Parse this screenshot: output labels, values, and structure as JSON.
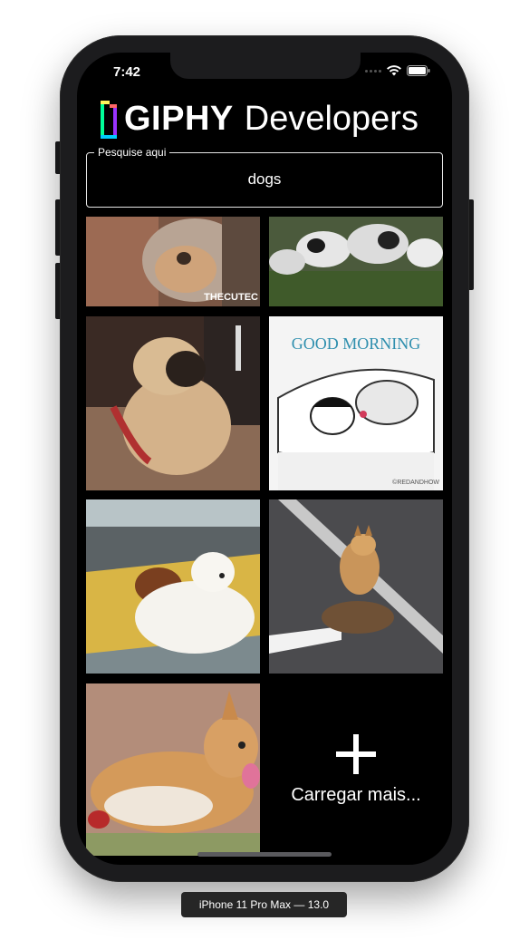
{
  "status_bar": {
    "time": "7:42"
  },
  "header": {
    "brand": "GIPHY",
    "subtitle": "Developers"
  },
  "search": {
    "label": "Pesquise aqui",
    "value": "dogs"
  },
  "gifs": [
    {
      "name": "gif-dog-closeup",
      "overlay": "THECUTEC"
    },
    {
      "name": "gif-cows-grass"
    },
    {
      "name": "gif-pug-on-couch"
    },
    {
      "name": "gif-good-morning-cartoon",
      "title": "GOOD MORNING",
      "credit": "©REDANDHOW"
    },
    {
      "name": "gif-two-dogs-blanket"
    },
    {
      "name": "gif-shiba-on-tortoise"
    },
    {
      "name": "gif-corgi-lying"
    }
  ],
  "load_more": {
    "label": "Carregar mais..."
  },
  "device_caption": "iPhone 11 Pro Max — 13.0",
  "colors": {
    "background": "#000000",
    "frame": "#1c1c1e",
    "text": "#ffffff"
  }
}
